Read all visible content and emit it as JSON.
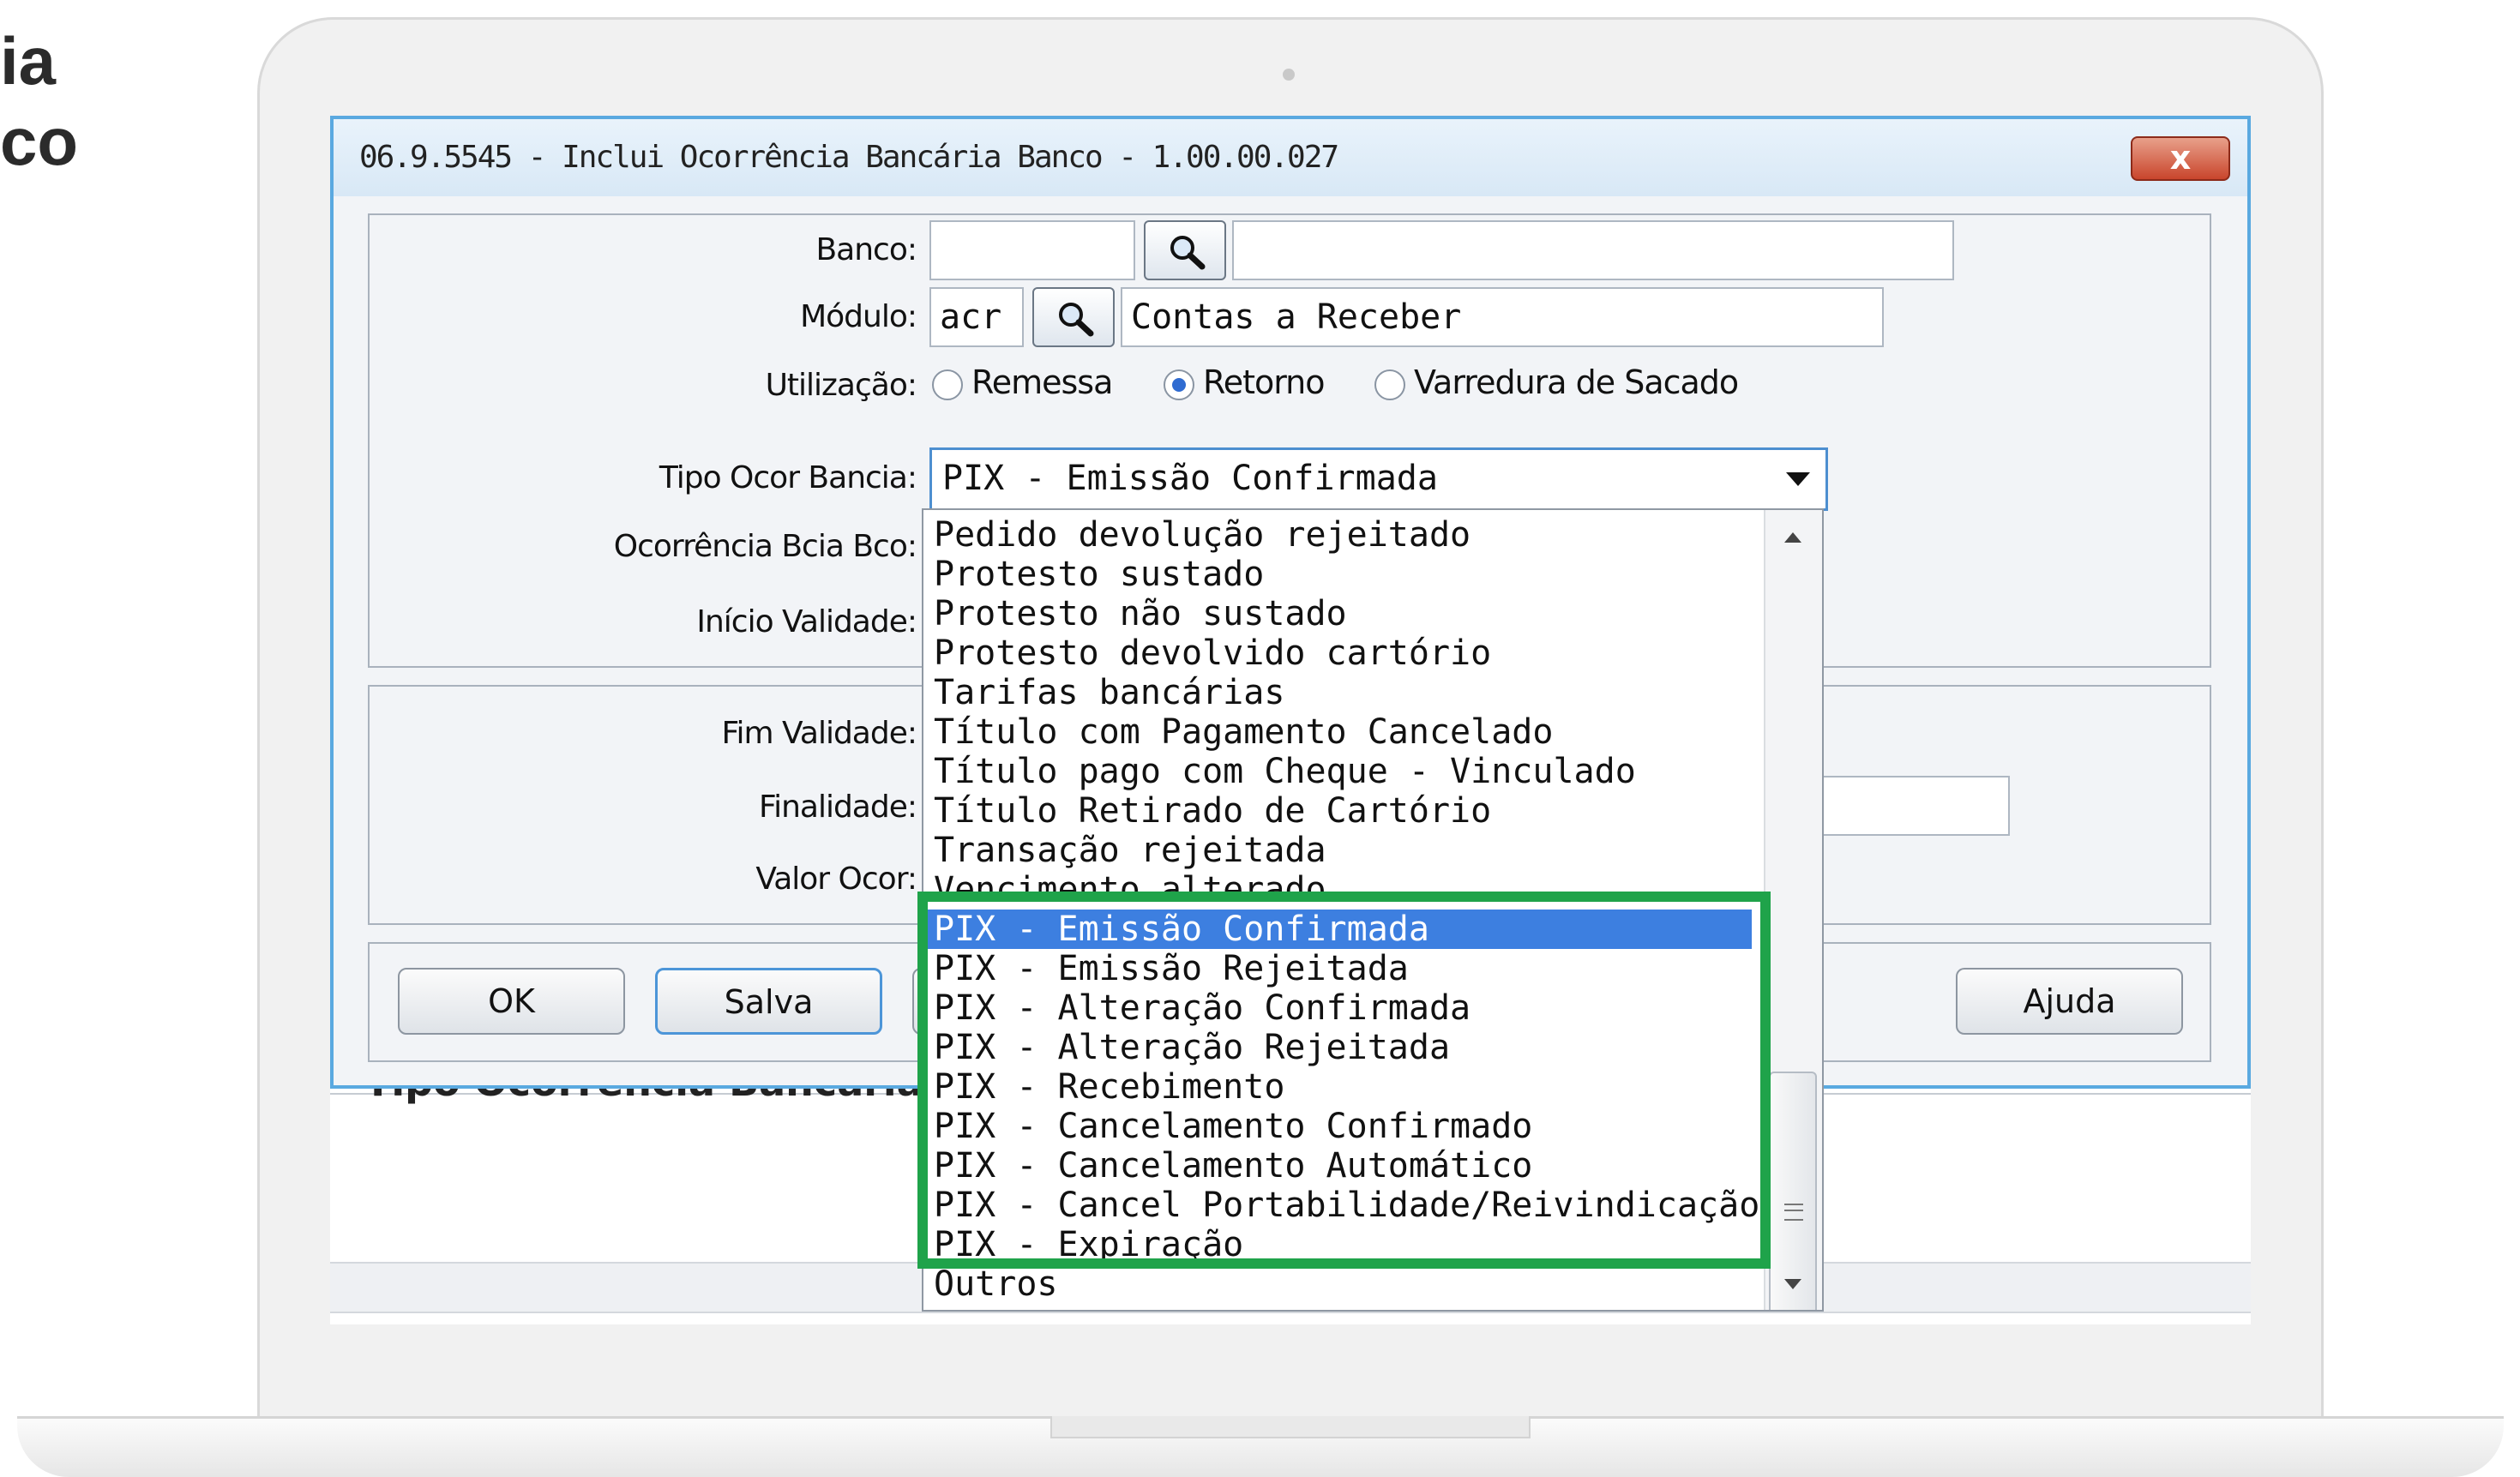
{
  "side_title": {
    "line1": "ia",
    "line2": "co"
  },
  "window": {
    "title": "06.9.5545 - Inclui Ocorrência Bancária Banco - 1.00.00.027",
    "close_label": "x"
  },
  "form": {
    "banco_label": "Banco:",
    "banco_value": "",
    "banco_desc": "",
    "modulo_label": "Módulo:",
    "modulo_value": "acr",
    "modulo_desc": "Contas a Receber",
    "utilizacao_label": "Utilização:",
    "utilizacao_options": [
      "Remessa",
      "Retorno",
      "Varredura de Sacado"
    ],
    "utilizacao_selected": "Retorno",
    "tipo_label": "Tipo Ocor Bancia:",
    "tipo_value": "PIX - Emissão Confirmada",
    "ocorrencia_label": "Ocorrência Bcia Bco:",
    "inicio_label": "Início Validade:",
    "fim_label": "Fim Validade:",
    "finalidade_label": "Finalidade:",
    "valor_label": "Valor Ocor:"
  },
  "buttons": {
    "ok": "OK",
    "salva": "Salva",
    "ajuda": "Ajuda"
  },
  "background_text": "Tipo Ocorrência Bancária",
  "dropdown": {
    "items": [
      "Pedido devolução rejeitado",
      "Protesto sustado",
      "Protesto não sustado",
      "Protesto devolvido cartório",
      "Tarifas bancárias",
      "Título com Pagamento Cancelado",
      "Título pago com Cheque - Vinculado",
      "Título Retirado de Cartório",
      "Transação rejeitada",
      "Vencimento alterado",
      "PIX - Emissão Confirmada",
      "PIX - Emissão Rejeitada",
      "PIX - Alteração Confirmada",
      "PIX - Alteração Rejeitada",
      "PIX - Recebimento",
      "PIX - Cancelamento Confirmado",
      "PIX - Cancelamento Automático",
      "PIX - Cancel Portabilidade/Reivindicação",
      "PIX - Expiração",
      "Outros"
    ],
    "selected": "PIX - Emissão Confirmada"
  },
  "colors": {
    "highlight": "#1fa34a",
    "selection": "#3d7fe0",
    "window_border": "#5aa9e0"
  }
}
